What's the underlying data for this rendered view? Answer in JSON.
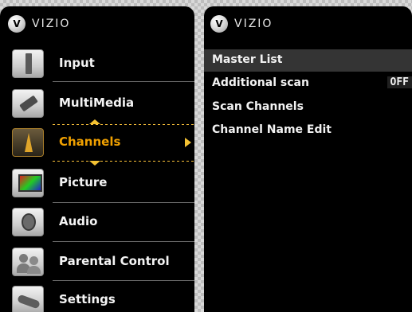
{
  "left_panel": {
    "brand": "VIZIO",
    "logo_letter": "V",
    "items": [
      {
        "label": "Input",
        "icon": "input-icon"
      },
      {
        "label": "MultiMedia",
        "icon": "usb-icon"
      },
      {
        "label": "Channels",
        "icon": "antenna-icon"
      },
      {
        "label": "Picture",
        "icon": "tv-screen-icon"
      },
      {
        "label": "Audio",
        "icon": "speaker-icon"
      },
      {
        "label": "Parental Control",
        "icon": "people-icon"
      },
      {
        "label": "Settings",
        "icon": "remote-icon"
      }
    ],
    "selected_index": 2
  },
  "right_panel": {
    "brand": "VIZIO",
    "logo_letter": "V",
    "items": [
      {
        "label": "Master List"
      },
      {
        "label": "Additional scan",
        "value": "OFF"
      },
      {
        "label": "Scan Channels"
      },
      {
        "label": "Channel Name Edit"
      }
    ],
    "active_index": 0
  },
  "colors": {
    "accent": "#f4c233",
    "selected_text": "#f0a000",
    "panel_bg": "#000000"
  }
}
